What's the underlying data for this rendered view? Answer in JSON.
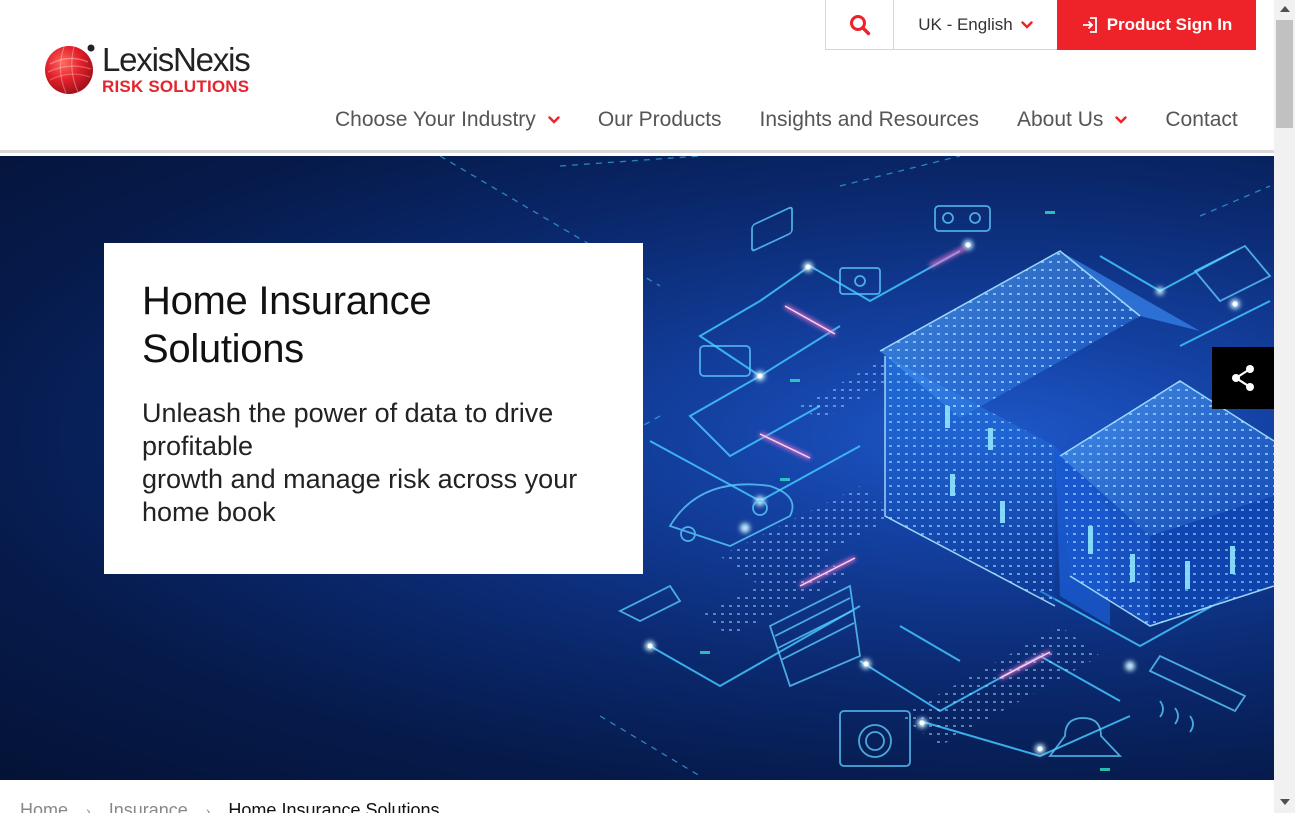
{
  "logo": {
    "brand": "LexisNexis",
    "sub": "RISK SOLUTIONS"
  },
  "utility": {
    "search_icon": "search-icon",
    "language": "UK - English",
    "signin_label": "Product Sign In",
    "accent": "#ee2229"
  },
  "nav": {
    "items": [
      {
        "label": "Choose Your Industry",
        "has_dropdown": true
      },
      {
        "label": "Our Products",
        "has_dropdown": false
      },
      {
        "label": "Insights and Resources",
        "has_dropdown": false
      },
      {
        "label": "About Us",
        "has_dropdown": true
      },
      {
        "label": "Contact",
        "has_dropdown": false
      }
    ]
  },
  "hero": {
    "title_line1": "Home Insurance",
    "title_line2": "Solutions",
    "sub_line1": "Unleash the power of data to drive",
    "sub_line2": "profitable",
    "sub_line3": "growth and manage risk across your",
    "sub_line4": "home book"
  },
  "share": {
    "icon": "share-icon"
  },
  "breadcrumb": {
    "items": [
      "Home",
      "Insurance",
      "Home Insurance Solutions"
    ]
  }
}
